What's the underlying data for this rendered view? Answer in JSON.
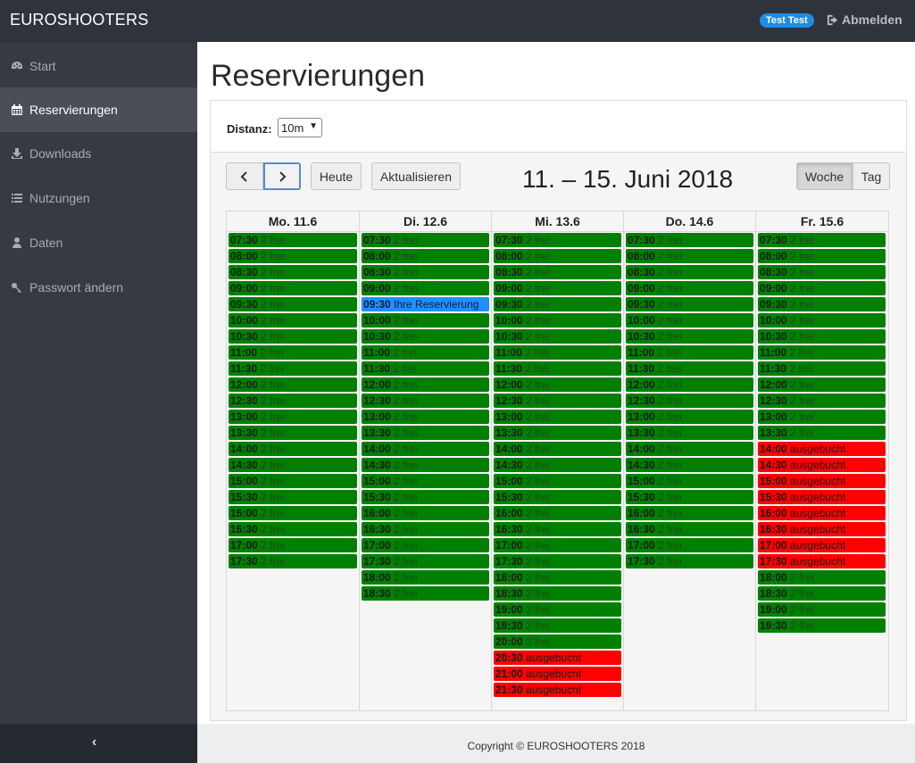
{
  "app": {
    "brand": "EUROSHOOTERS"
  },
  "header": {
    "user": "Test Test",
    "logout_label": "Abmelden"
  },
  "sidebar": {
    "items": [
      {
        "label": "Start",
        "icon": "dashboard-icon",
        "active": false
      },
      {
        "label": "Reservierungen",
        "icon": "calendar-icon",
        "active": true
      },
      {
        "label": "Downloads",
        "icon": "download-icon",
        "active": false
      },
      {
        "label": "Nutzungen",
        "icon": "list-icon",
        "active": false
      },
      {
        "label": "Daten",
        "icon": "user-icon",
        "active": false
      },
      {
        "label": "Passwort ändern",
        "icon": "key-icon",
        "active": false
      }
    ],
    "collapse_label": "‹"
  },
  "page": {
    "title": "Reservierungen"
  },
  "filter": {
    "distance_label": "Distanz:",
    "distance_value": "10m"
  },
  "toolbar": {
    "today_label": "Heute",
    "refresh_label": "Aktualisieren",
    "week_label": "Woche",
    "day_label": "Tag",
    "range_title": "11. – 15. Juni 2018"
  },
  "calendar": {
    "days": [
      {
        "label": "Mo. 11.6",
        "slots": [
          [
            "07:30",
            "2 frei",
            "free"
          ],
          [
            "08:00",
            "2 frei",
            "free"
          ],
          [
            "08:30",
            "2 frei",
            "free"
          ],
          [
            "09:00",
            "2 frei",
            "free"
          ],
          [
            "09:30",
            "2 frei",
            "free"
          ],
          [
            "10:00",
            "2 frei",
            "free"
          ],
          [
            "10:30",
            "2 frei",
            "free"
          ],
          [
            "11:00",
            "2 frei",
            "free"
          ],
          [
            "11:30",
            "2 frei",
            "free"
          ],
          [
            "12:00",
            "2 frei",
            "free"
          ],
          [
            "12:30",
            "2 frei",
            "free"
          ],
          [
            "13:00",
            "2 frei",
            "free"
          ],
          [
            "13:30",
            "2 frei",
            "free"
          ],
          [
            "14:00",
            "2 frei",
            "free"
          ],
          [
            "14:30",
            "2 frei",
            "free"
          ],
          [
            "15:00",
            "2 frei",
            "free"
          ],
          [
            "15:30",
            "2 frei",
            "free"
          ],
          [
            "16:00",
            "2 frei",
            "free"
          ],
          [
            "16:30",
            "2 frei",
            "free"
          ],
          [
            "17:00",
            "2 frei",
            "free"
          ],
          [
            "17:30",
            "2 frei",
            "free"
          ]
        ]
      },
      {
        "label": "Di. 12.6",
        "slots": [
          [
            "07:30",
            "2 frei",
            "free"
          ],
          [
            "08:00",
            "2 frei",
            "free"
          ],
          [
            "08:30",
            "2 frei",
            "free"
          ],
          [
            "09:00",
            "2 frei",
            "free"
          ],
          [
            "09:30",
            "Ihre Reservierung",
            "own"
          ],
          [
            "10:00",
            "2 frei",
            "free"
          ],
          [
            "10:30",
            "2 frei",
            "free"
          ],
          [
            "11:00",
            "2 frei",
            "free"
          ],
          [
            "11:30",
            "2 frei",
            "free"
          ],
          [
            "12:00",
            "2 frei",
            "free"
          ],
          [
            "12:30",
            "2 frei",
            "free"
          ],
          [
            "13:00",
            "2 frei",
            "free"
          ],
          [
            "13:30",
            "2 frei",
            "free"
          ],
          [
            "14:00",
            "2 frei",
            "free"
          ],
          [
            "14:30",
            "2 frei",
            "free"
          ],
          [
            "15:00",
            "2 frei",
            "free"
          ],
          [
            "15:30",
            "2 frei",
            "free"
          ],
          [
            "16:00",
            "2 frei",
            "free"
          ],
          [
            "16:30",
            "2 frei",
            "free"
          ],
          [
            "17:00",
            "2 frei",
            "free"
          ],
          [
            "17:30",
            "2 frei",
            "free"
          ],
          [
            "18:00",
            "2 frei",
            "free"
          ],
          [
            "18:30",
            "2 frei",
            "free"
          ]
        ]
      },
      {
        "label": "Mi. 13.6",
        "slots": [
          [
            "07:30",
            "2 frei",
            "free"
          ],
          [
            "08:00",
            "2 frei",
            "free"
          ],
          [
            "08:30",
            "2 frei",
            "free"
          ],
          [
            "09:00",
            "2 frei",
            "free"
          ],
          [
            "09:30",
            "2 frei",
            "free"
          ],
          [
            "10:00",
            "2 frei",
            "free"
          ],
          [
            "10:30",
            "2 frei",
            "free"
          ],
          [
            "11:00",
            "2 frei",
            "free"
          ],
          [
            "11:30",
            "2 frei",
            "free"
          ],
          [
            "12:00",
            "2 frei",
            "free"
          ],
          [
            "12:30",
            "2 frei",
            "free"
          ],
          [
            "13:00",
            "2 frei",
            "free"
          ],
          [
            "13:30",
            "2 frei",
            "free"
          ],
          [
            "14:00",
            "2 frei",
            "free"
          ],
          [
            "14:30",
            "2 frei",
            "free"
          ],
          [
            "15:00",
            "2 frei",
            "free"
          ],
          [
            "15:30",
            "2 frei",
            "free"
          ],
          [
            "16:00",
            "2 frei",
            "free"
          ],
          [
            "16:30",
            "2 frei",
            "free"
          ],
          [
            "17:00",
            "2 frei",
            "free"
          ],
          [
            "17:30",
            "2 frei",
            "free"
          ],
          [
            "18:00",
            "2 frei",
            "free"
          ],
          [
            "18:30",
            "2 frei",
            "free"
          ],
          [
            "19:00",
            "2 frei",
            "free"
          ],
          [
            "19:30",
            "2 frei",
            "free"
          ],
          [
            "20:00",
            "2 frei",
            "free"
          ],
          [
            "20:30",
            "ausgebucht",
            "booked"
          ],
          [
            "21:00",
            "ausgebucht",
            "booked"
          ],
          [
            "21:30",
            "ausgebucht",
            "booked"
          ]
        ]
      },
      {
        "label": "Do. 14.6",
        "slots": [
          [
            "07:30",
            "2 frei",
            "free"
          ],
          [
            "08:00",
            "2 frei",
            "free"
          ],
          [
            "08:30",
            "2 frei",
            "free"
          ],
          [
            "09:00",
            "2 frei",
            "free"
          ],
          [
            "09:30",
            "2 frei",
            "free"
          ],
          [
            "10:00",
            "2 frei",
            "free"
          ],
          [
            "10:30",
            "2 frei",
            "free"
          ],
          [
            "11:00",
            "2 frei",
            "free"
          ],
          [
            "11:30",
            "2 frei",
            "free"
          ],
          [
            "12:00",
            "2 frei",
            "free"
          ],
          [
            "12:30",
            "2 frei",
            "free"
          ],
          [
            "13:00",
            "2 frei",
            "free"
          ],
          [
            "13:30",
            "2 frei",
            "free"
          ],
          [
            "14:00",
            "2 frei",
            "free"
          ],
          [
            "14:30",
            "2 frei",
            "free"
          ],
          [
            "15:00",
            "2 frei",
            "free"
          ],
          [
            "15:30",
            "2 frei",
            "free"
          ],
          [
            "16:00",
            "2 frei",
            "free"
          ],
          [
            "16:30",
            "2 frei",
            "free"
          ],
          [
            "17:00",
            "2 frei",
            "free"
          ],
          [
            "17:30",
            "2 frei",
            "free"
          ]
        ]
      },
      {
        "label": "Fr. 15.6",
        "slots": [
          [
            "07:30",
            "2 frei",
            "free"
          ],
          [
            "08:00",
            "2 frei",
            "free"
          ],
          [
            "08:30",
            "2 frei",
            "free"
          ],
          [
            "09:00",
            "2 frei",
            "free"
          ],
          [
            "09:30",
            "2 frei",
            "free"
          ],
          [
            "10:00",
            "2 frei",
            "free"
          ],
          [
            "10:30",
            "2 frei",
            "free"
          ],
          [
            "11:00",
            "2 frei",
            "free"
          ],
          [
            "11:30",
            "2 frei",
            "free"
          ],
          [
            "12:00",
            "2 frei",
            "free"
          ],
          [
            "12:30",
            "2 frei",
            "free"
          ],
          [
            "13:00",
            "2 frei",
            "free"
          ],
          [
            "13:30",
            "2 frei",
            "free"
          ],
          [
            "14:00",
            "ausgebucht",
            "booked"
          ],
          [
            "14:30",
            "ausgebucht",
            "booked"
          ],
          [
            "15:00",
            "ausgebucht",
            "booked"
          ],
          [
            "15:30",
            "ausgebucht",
            "booked"
          ],
          [
            "16:00",
            "ausgebucht",
            "booked"
          ],
          [
            "16:30",
            "ausgebucht",
            "booked"
          ],
          [
            "17:00",
            "ausgebucht",
            "booked"
          ],
          [
            "17:30",
            "ausgebucht",
            "booked"
          ],
          [
            "18:00",
            "2 frei",
            "free"
          ],
          [
            "18:30",
            "2 frei",
            "free"
          ],
          [
            "19:00",
            "2 frei",
            "free"
          ],
          [
            "19:30",
            "2 frei",
            "free"
          ]
        ]
      }
    ]
  },
  "footer": {
    "copyright": "Copyright © EUROSHOOTERS 2018"
  }
}
